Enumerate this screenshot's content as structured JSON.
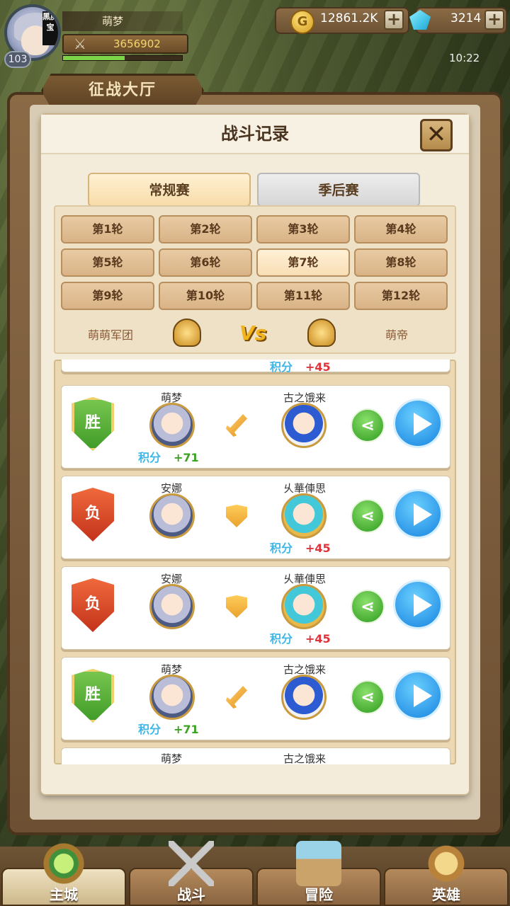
{
  "player": {
    "name": "萌梦",
    "level": "103",
    "power": "3656902",
    "tag": "黑魔宝",
    "exp_fraction": 0.52
  },
  "currency": {
    "gold": "12861.2K",
    "gems": "3214",
    "coin_glyph": "G"
  },
  "clock": "10:22",
  "hall_title": "征战大厅",
  "dialog": {
    "title": "战斗记录",
    "close_glyph": "✕",
    "tabs": [
      {
        "label": "常规赛"
      },
      {
        "label": "季后赛"
      }
    ],
    "rounds": [
      "第1轮",
      "第2轮",
      "第3轮",
      "第4轮",
      "第5轮",
      "第6轮",
      "第7轮",
      "第8轮",
      "第9轮",
      "第10轮",
      "第11轮",
      "第12轮"
    ],
    "selected_round": "第7轮",
    "team_left": "萌萌军团",
    "team_right": "萌帝",
    "vs": "Vs",
    "top_partial": {
      "label": "积分",
      "value": "+45"
    },
    "records": [
      {
        "result": "胜",
        "left": "萌梦",
        "right": "古之饿来",
        "points_label": "积分",
        "points": "+71"
      },
      {
        "result": "负",
        "left": "安娜",
        "right": "乆華俥思",
        "points_label": "积分",
        "points": "+45"
      },
      {
        "result": "负",
        "left": "安娜",
        "right": "乆華俥思",
        "points_label": "积分",
        "points": "+45"
      },
      {
        "result": "胜",
        "left": "萌梦",
        "right": "古之饿来",
        "points_label": "积分",
        "points": "+71"
      }
    ],
    "bottom_partial": {
      "left": "萌梦",
      "right": "古之饿来"
    }
  },
  "nav": [
    {
      "label": "主城"
    },
    {
      "label": "战斗"
    },
    {
      "label": "冒险"
    },
    {
      "label": "英雄"
    }
  ]
}
